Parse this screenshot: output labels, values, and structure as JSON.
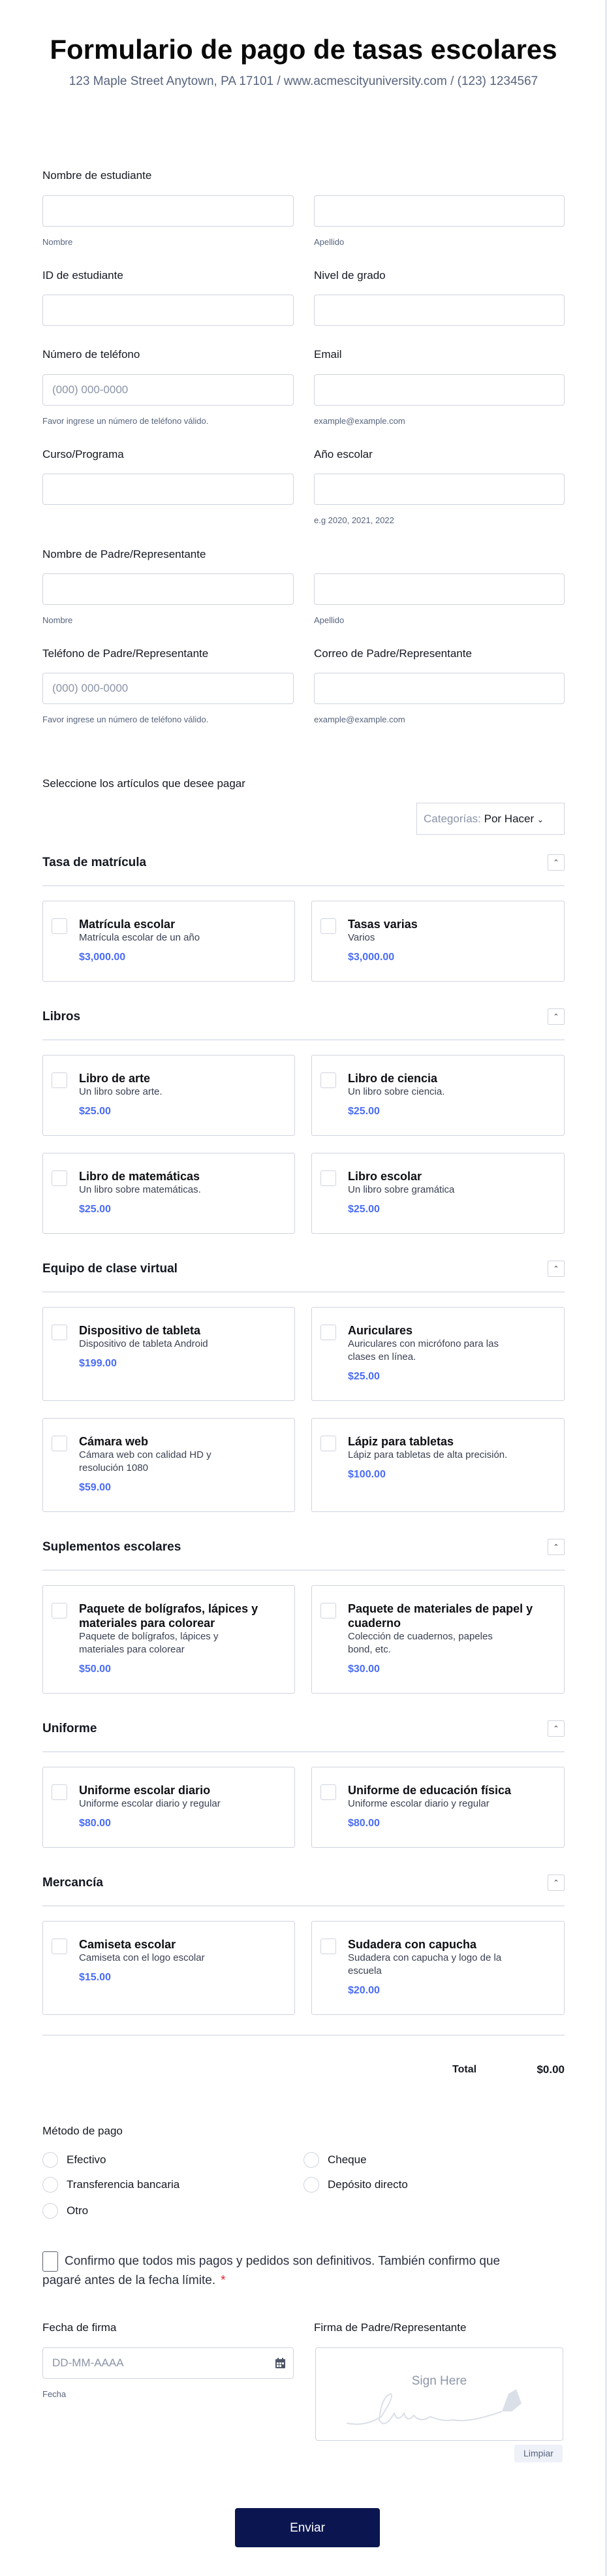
{
  "header": {
    "title": "Formulario de pago de tasas escolares",
    "subtitle": "123 Maple Street Anytown, PA 17101 / www.acmescityuniversity.com / (123) 1234567"
  },
  "fields": {
    "student_name": {
      "label": "Nombre de estudiante",
      "first": "Nombre",
      "last": "Apellido"
    },
    "student_id": {
      "label": "ID de estudiante"
    },
    "grade": {
      "label": "Nivel de grado"
    },
    "phone": {
      "label": "Número de teléfono",
      "placeholder": "(000) 000-0000",
      "hint": "Favor ingrese un número de teléfono válido."
    },
    "email": {
      "label": "Email",
      "hint": "example@example.com"
    },
    "course": {
      "label": "Curso/Programa"
    },
    "school_year": {
      "label": "Año escolar",
      "hint": "e.g 2020, 2021, 2022"
    },
    "parent_name": {
      "label": "Nombre de Padre/Representante",
      "first": "Nombre",
      "last": "Apellido"
    },
    "parent_phone": {
      "label": "Teléfono de Padre/Representante",
      "placeholder": "(000) 000-0000",
      "hint": "Favor ingrese un número de teléfono válido."
    },
    "parent_email": {
      "label": "Correo de Padre/Representante",
      "hint": "example@example.com"
    }
  },
  "products": {
    "label": "Seleccione los artículos que desee pagar",
    "filter_key": "Categorías:",
    "filter_value": "Por Hacer",
    "categories": [
      {
        "name": "Tasa de matrícula",
        "items": [
          {
            "title": "Matrícula escolar",
            "desc": "Matrícula escolar de un año",
            "price": "$3,000.00"
          },
          {
            "title": "Tasas varias",
            "desc": "Varios",
            "price": "$3,000.00"
          }
        ]
      },
      {
        "name": "Libros",
        "items": [
          {
            "title": "Libro de arte",
            "desc": "Un libro sobre arte.",
            "price": "$25.00"
          },
          {
            "title": "Libro de ciencia",
            "desc": "Un libro sobre ciencia.",
            "price": "$25.00"
          },
          {
            "title": "Libro de matemáticas",
            "desc": "Un libro sobre matemáticas.",
            "price": "$25.00"
          },
          {
            "title": "Libro escolar",
            "desc": "Un libro sobre gramática",
            "price": "$25.00"
          }
        ]
      },
      {
        "name": "Equipo de clase virtual",
        "items": [
          {
            "title": "Dispositivo de tableta",
            "desc": "Dispositivo de tableta Android",
            "price": "$199.00"
          },
          {
            "title": "Auriculares",
            "desc": "Auriculares con micrófono para las clases en línea.",
            "price": "$25.00"
          },
          {
            "title": "Cámara web",
            "desc": "Cámara web con calidad HD y resolución 1080",
            "price": "$59.00"
          },
          {
            "title": "Lápiz para tabletas",
            "desc": "Lápiz para tabletas de alta precisión.",
            "price": "$100.00"
          }
        ]
      },
      {
        "name": "Suplementos escolares",
        "items": [
          {
            "title": "Paquete de bolígrafos, lápices y materiales para colorear",
            "desc": "Paquete de bolígrafos, lápices y materiales para colorear",
            "price": "$50.00"
          },
          {
            "title": "Paquete de materiales de papel y cuaderno",
            "desc": "Colección de cuadernos, papeles bond, etc.",
            "price": "$30.00"
          }
        ]
      },
      {
        "name": "Uniforme",
        "items": [
          {
            "title": "Uniforme escolar diario",
            "desc": "Uniforme escolar diario y regular",
            "price": "$80.00"
          },
          {
            "title": "Uniforme de educación física",
            "desc": "Uniforme escolar diario y regular",
            "price": "$80.00"
          }
        ]
      },
      {
        "name": "Mercancía",
        "items": [
          {
            "title": "Camiseta escolar",
            "desc": "Camiseta con el logo escolar",
            "price": "$15.00"
          },
          {
            "title": "Sudadera con capucha",
            "desc": "Sudadera con capucha y logo de la escuela",
            "price": "$20.00"
          }
        ]
      }
    ],
    "total_label": "Total",
    "total_value": "$0.00"
  },
  "payment": {
    "label": "Método de pago",
    "options": [
      "Efectivo",
      "Cheque",
      "Transferencia bancaria",
      "Depósito directo",
      "Otro"
    ]
  },
  "confirm": {
    "text": "Confirmo que todos mis pagos y pedidos son definitivos. También confirmo que pagaré antes de la fecha límite.",
    "required": "*"
  },
  "date": {
    "label": "Fecha de firma",
    "placeholder": "DD-MM-AAAA",
    "sublabel": "Fecha"
  },
  "signature": {
    "label": "Firma de Padre/Representante",
    "hint": "Sign Here",
    "clear": "Limpiar"
  },
  "submit": "Enviar",
  "colors": {
    "accent": "#4a6cf7",
    "submit": "#0b1650",
    "required": "#e0242f"
  }
}
